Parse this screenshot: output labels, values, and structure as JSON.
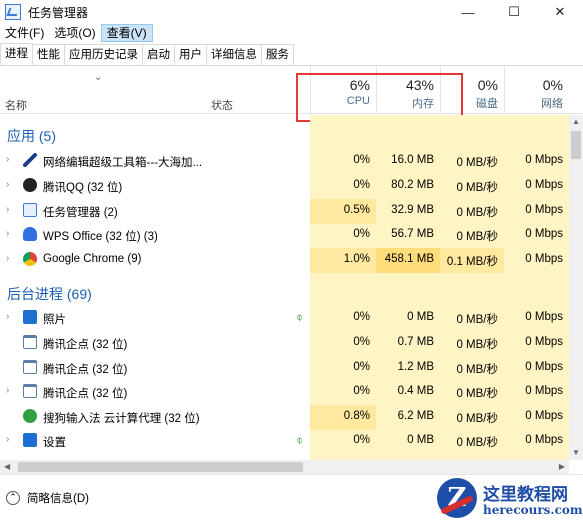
{
  "window": {
    "title": "任务管理器",
    "controls": {
      "minimize": "—",
      "maximize": "☐",
      "close": "✕"
    }
  },
  "menu": [
    "文件(F)",
    "选项(O)",
    "查看(V)"
  ],
  "tabs": [
    "进程",
    "性能",
    "应用历史记录",
    "启动",
    "用户",
    "详细信息",
    "服务"
  ],
  "header": {
    "name": "名称",
    "status": "状态",
    "cpu": {
      "pct": "6%",
      "label": "CPU"
    },
    "mem": {
      "pct": "43%",
      "label": "内存"
    },
    "disk": {
      "pct": "0%",
      "label": "磁盘"
    },
    "net": {
      "pct": "0%",
      "label": "网络"
    }
  },
  "sections": {
    "apps": "应用 (5)",
    "background": "后台进程 (69)"
  },
  "rows": [
    {
      "name": "网络编辑超级工具箱---大海加...",
      "icon": "pen-icon",
      "cpu": "0%",
      "mem": "16.0 MB",
      "disk": "0 MB/秒",
      "net": "0 Mbps"
    },
    {
      "name": "腾讯QQ (32 位)",
      "icon": "qq-icon",
      "cpu": "0%",
      "mem": "80.2 MB",
      "disk": "0 MB/秒",
      "net": "0 Mbps"
    },
    {
      "name": "任务管理器 (2)",
      "icon": "task-manager-icon",
      "cpu": "0.5%",
      "mem": "32.9 MB",
      "disk": "0 MB/秒",
      "net": "0 Mbps"
    },
    {
      "name": "WPS Office (32 位) (3)",
      "icon": "wps-icon",
      "cpu": "0%",
      "mem": "56.7 MB",
      "disk": "0 MB/秒",
      "net": "0 Mbps"
    },
    {
      "name": "Google Chrome (9)",
      "icon": "chrome-icon",
      "cpu": "1.0%",
      "mem": "458.1 MB",
      "disk": "0.1 MB/秒",
      "net": "0 Mbps"
    },
    {
      "name": "照片",
      "icon": "photos-icon",
      "cpu": "0%",
      "mem": "0 MB",
      "disk": "0 MB/秒",
      "net": "0 Mbps"
    },
    {
      "name": "腾讯企点 (32 位)",
      "icon": "window-icon",
      "cpu": "0%",
      "mem": "0.7 MB",
      "disk": "0 MB/秒",
      "net": "0 Mbps"
    },
    {
      "name": "腾讯企点 (32 位)",
      "icon": "window-icon",
      "cpu": "0%",
      "mem": "1.2 MB",
      "disk": "0 MB/秒",
      "net": "0 Mbps"
    },
    {
      "name": "腾讯企点 (32 位)",
      "icon": "window-icon",
      "cpu": "0%",
      "mem": "0.4 MB",
      "disk": "0 MB/秒",
      "net": "0 Mbps"
    },
    {
      "name": "搜狗输入法 云计算代理 (32 位)",
      "icon": "sogou-icon",
      "cpu": "0.8%",
      "mem": "6.2 MB",
      "disk": "0 MB/秒",
      "net": "0 Mbps"
    },
    {
      "name": "设置",
      "icon": "settings-icon",
      "cpu": "0%",
      "mem": "0 MB",
      "disk": "0 MB/秒",
      "net": "0 Mbps"
    }
  ],
  "footer": {
    "fewer_details": "简略信息(D)"
  },
  "watermark": {
    "title": "这里教程网",
    "url": "herecours.com",
    "logo": "Z"
  },
  "colors": {
    "accent": "#1a5fb4",
    "cell_light": "#fff4c4",
    "cell_mid": "#ffe9a0",
    "highlight_box": "#e53935"
  }
}
